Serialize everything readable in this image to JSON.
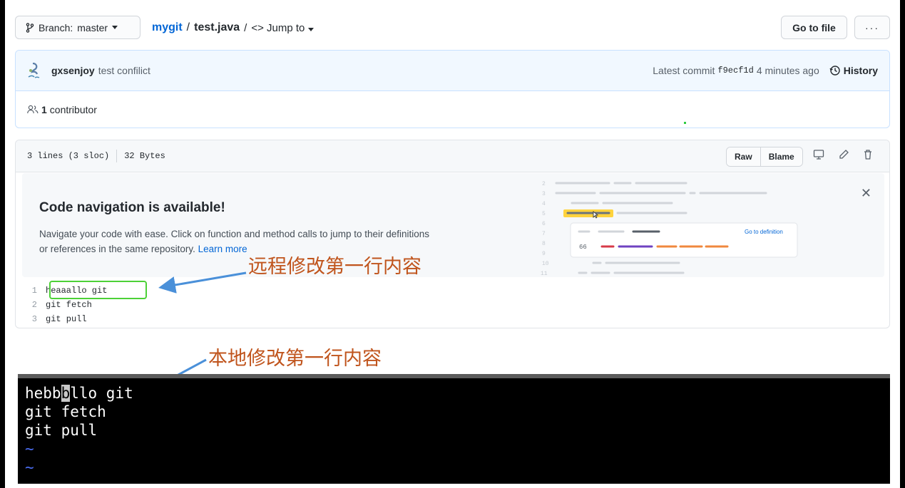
{
  "header": {
    "branch_label": "Branch:",
    "branch_name": "master",
    "repo": "mygit",
    "slash": "/",
    "file": "test.java",
    "jump_prefix": "/",
    "jump_label": "Jump to",
    "go_to_file": "Go to file",
    "more": "···"
  },
  "commit": {
    "author": "gxsenjoy",
    "message": "test confilict",
    "latest_label": "Latest commit",
    "sha": "f9ecf1d",
    "time": "4 minutes ago",
    "history": "History",
    "contributors_count": "1",
    "contributors_label": "contributor"
  },
  "file": {
    "lines": "3 lines (3 sloc)",
    "size": "32 Bytes",
    "raw": "Raw",
    "blame": "Blame"
  },
  "banner": {
    "title": "Code navigation is available!",
    "text": "Navigate your code with ease. Click on function and method calls to jump to their definitions or references in the same repository.",
    "link": "Learn more",
    "preview_link": "Go to definition",
    "preview_num": "66",
    "preview_line_numbers": [
      "2",
      "3",
      "4",
      "5",
      "6",
      "7",
      "8",
      "9",
      "10",
      "11"
    ]
  },
  "code_lines": [
    {
      "n": "1",
      "text": "heaaallo git"
    },
    {
      "n": "2",
      "text": "git fetch"
    },
    {
      "n": "3",
      "text": "git pull"
    }
  ],
  "annotations": {
    "remote": "远程修改第一行内容",
    "local": "本地修改第一行内容"
  },
  "terminal": {
    "line1_pre": "hebb",
    "line1_cursor": "b",
    "line1_post": "llo git",
    "line2": "git fetch",
    "line3": "git pull",
    "tilde": "~"
  },
  "colors": {
    "link": "#0366d6",
    "annotation": "#c0541c",
    "highlight_box": "#4cd137",
    "arrow": "#4a90d9"
  }
}
